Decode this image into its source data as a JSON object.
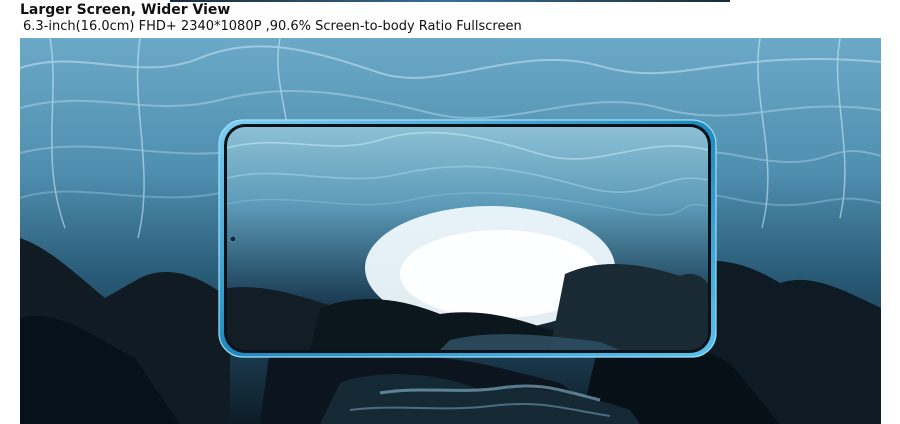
{
  "page": {
    "title": "Larger Screen, Wider View",
    "subtitle": "6.3-inch(16.0cm) FHD+ 2340*1080P ,90.6% Screen-to-body Ratio Fullscreen"
  },
  "banner": {
    "scene": "ice-cave",
    "device": "smartphone",
    "colors": {
      "ice_light": "#8fc6df",
      "ice_mid": "#3f7f9d",
      "ice_dark": "#173e53",
      "rock": "#0d1820",
      "phone_frame": "#31a7dc"
    }
  }
}
